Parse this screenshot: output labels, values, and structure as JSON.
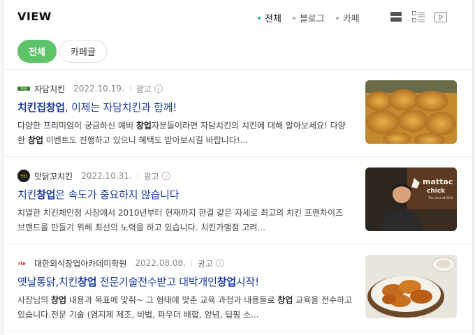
{
  "header": {
    "title": "VIEW"
  },
  "filters": [
    {
      "label": "전체",
      "active": true
    },
    {
      "label": "블로그",
      "active": false
    },
    {
      "label": "카페",
      "active": false
    }
  ],
  "icons": [
    "list-view-icon",
    "detail-view-icon",
    "video-icon"
  ],
  "chips": [
    {
      "label": "전체",
      "active": true
    },
    {
      "label": "카페글",
      "active": false
    }
  ],
  "results": [
    {
      "source": "자담치킨",
      "date": "2022.10.19.",
      "ad": "광고",
      "title_pre": "",
      "title_hl": "치킨집창업",
      "title_post": ", 이제는 자담치킨과 함께!",
      "desc_1": "다양한 프리미엄이 궁금하신 예비 ",
      "desc_1_hl": "창업",
      "desc_1_post": "자분들이라면 자담치킨의 치킨에 대해 알아보세요! 다양한 ",
      "desc_2_hl": "창업",
      "desc_2_post": " 이벤트도 진행하고 있으니 혜택도 받아보시길 바랍니다!..."
    },
    {
      "source": "맛닭꼬치킨",
      "date": "2022.10.31.",
      "ad": "광고",
      "title_pre": "치킨",
      "title_hl": "창업",
      "title_post": "은 속도가 중요하지 않습니다",
      "desc_1": "치열한 치킨체인점 시장에서 2010년부터 현재까지 한결 같은 자세로 최고의 치킨 프랜차이즈 브랜드를 만들기 위해 최선의 노력을 하고 있습니다. 치킨가맹점 고려..."
    },
    {
      "source": "대한외식창업아카데미학원",
      "date": "2022.08.08.",
      "ad": "광고",
      "title_pre": "옛날통닭,치킨",
      "title_hl": "창업",
      "title_mid": " 전문기술전수받고 대박개인",
      "title_hl2": "창업",
      "title_post": "시작!",
      "desc_1": "사장님의 ",
      "desc_1_hl": "창업",
      "desc_1_post": " 내용과 목표에 맞춰~ 그 형태에 맞춘 교육 과정과 내용들로 ",
      "desc_2_hl": "창업",
      "desc_2_post": " 교육을 전수하고 있습니다.전문 기술 (염지제 제조, 비법, 파우더 배합, 양념, 딥핑 소..."
    }
  ],
  "thumb_labels": {
    "thumb2_brand": "mattac",
    "thumb2_brand_2": "chick",
    "thumb2_since": "The since of 2010"
  },
  "favicon_labels": {
    "fav1": "자담",
    "fav2": "맛닭",
    "fav3": "rie"
  }
}
